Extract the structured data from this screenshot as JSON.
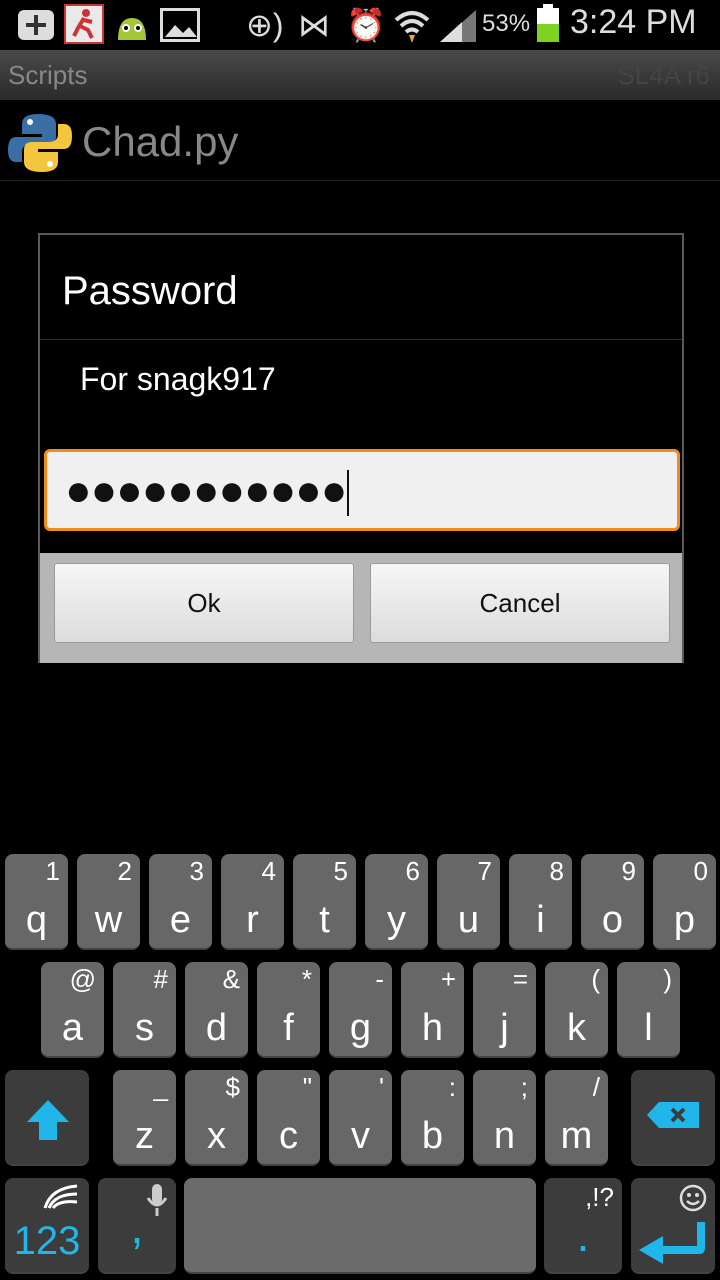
{
  "status_bar": {
    "notification_icons": [
      "plus-icon",
      "runner-icon",
      "android-icon",
      "image-icon"
    ],
    "system_icons": [
      "nfc-icon",
      "vibrate-icon",
      "alarm-icon",
      "wifi-icon",
      "signal-icon",
      "battery-icon"
    ],
    "battery_percent": "53%",
    "battery_level": 0.53,
    "time": "3:24 PM"
  },
  "app_bar": {
    "title": "Scripts",
    "version": "SL4A r6"
  },
  "script_list": {
    "items": [
      {
        "name": "Chad.py",
        "icon": "python-icon"
      }
    ]
  },
  "dialog": {
    "title": "Password",
    "message": "For snagk917",
    "password_mask": "●●●●●●●●●●●",
    "ok_label": "Ok",
    "cancel_label": "Cancel",
    "focus_color": "#f08c1a"
  },
  "keyboard": {
    "accent_color": "#20b6ea",
    "row1": [
      {
        "main": "q",
        "sec": "1"
      },
      {
        "main": "w",
        "sec": "2"
      },
      {
        "main": "e",
        "sec": "3"
      },
      {
        "main": "r",
        "sec": "4"
      },
      {
        "main": "t",
        "sec": "5"
      },
      {
        "main": "y",
        "sec": "6"
      },
      {
        "main": "u",
        "sec": "7"
      },
      {
        "main": "i",
        "sec": "8"
      },
      {
        "main": "o",
        "sec": "9"
      },
      {
        "main": "p",
        "sec": "0"
      }
    ],
    "row2": [
      {
        "main": "a",
        "sec": "@"
      },
      {
        "main": "s",
        "sec": "#"
      },
      {
        "main": "d",
        "sec": "&"
      },
      {
        "main": "f",
        "sec": "*"
      },
      {
        "main": "g",
        "sec": "-"
      },
      {
        "main": "h",
        "sec": "+"
      },
      {
        "main": "j",
        "sec": "="
      },
      {
        "main": "k",
        "sec": "("
      },
      {
        "main": "l",
        "sec": ")"
      }
    ],
    "row3": [
      {
        "main": "z",
        "sec": "_"
      },
      {
        "main": "x",
        "sec": "$"
      },
      {
        "main": "c",
        "sec": "\""
      },
      {
        "main": "v",
        "sec": "'"
      },
      {
        "main": "b",
        "sec": ":"
      },
      {
        "main": "n",
        "sec": ";"
      },
      {
        "main": "m",
        "sec": "/"
      }
    ],
    "symbols_label": "123",
    "comma_label": ",",
    "period_label": ".",
    "punct_label": ",!?",
    "shift_icon": "shift-icon",
    "backspace_icon": "backspace-icon",
    "mic_icon": "mic-icon",
    "swiftkey_icon": "swiftkey-icon",
    "smiley_icon": "smiley-icon",
    "enter_icon": "enter-icon"
  }
}
